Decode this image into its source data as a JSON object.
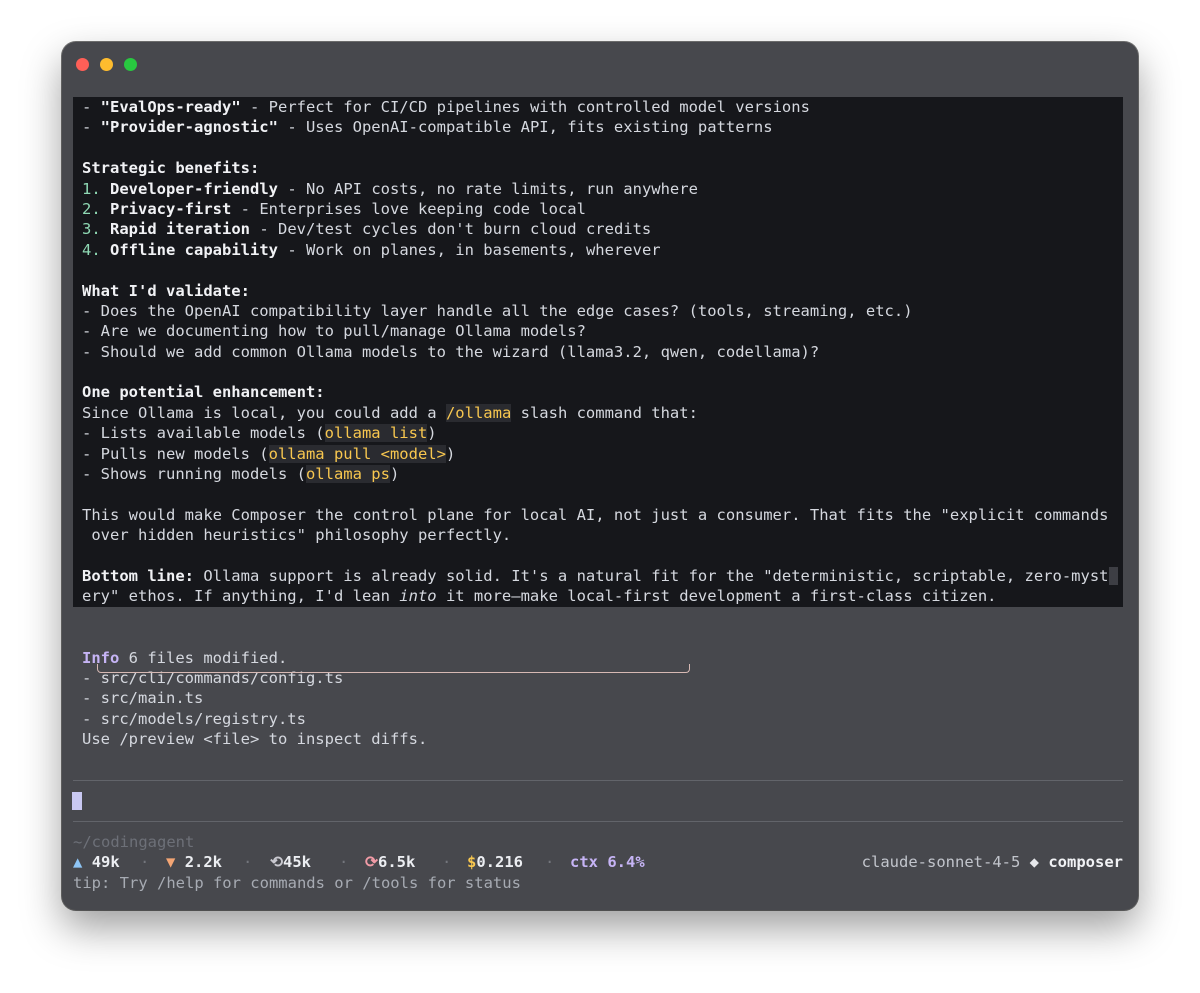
{
  "response": {
    "bullets_top": [
      {
        "bold": "\"EvalOps-ready\"",
        "rest": " - Perfect for CI/CD pipelines with controlled model versions"
      },
      {
        "bold": "\"Provider-agnostic\"",
        "rest": " - Uses OpenAI-compatible API, fits existing patterns"
      }
    ],
    "strategic": {
      "heading": "Strategic benefits:",
      "items": [
        {
          "n": "1.",
          "bold": "Developer-friendly",
          "rest": " - No API costs, no rate limits, run anywhere"
        },
        {
          "n": "2.",
          "bold": "Privacy-first",
          "rest": " - Enterprises love keeping code local"
        },
        {
          "n": "3.",
          "bold": "Rapid iteration",
          "rest": " - Dev/test cycles don't burn cloud credits"
        },
        {
          "n": "4.",
          "bold": "Offline capability",
          "rest": " - Work on planes, in basements, wherever"
        }
      ]
    },
    "validate": {
      "heading": "What I'd validate:",
      "items": [
        "- Does the OpenAI compatibility layer handle all the edge cases? (tools, streaming, etc.)",
        "- Are we documenting how to pull/manage Ollama models?",
        "- Should we add common Ollama models to the wizard (llama3.2, qwen, codellama)?"
      ]
    },
    "enhancement": {
      "heading": "One potential enhancement:",
      "intro_pre": "Since Ollama is local, you could add a ",
      "intro_code": "/ollama",
      "intro_post": " slash command that:",
      "items": [
        {
          "pre": "- Lists available models (",
          "code": "ollama list",
          "post": ")"
        },
        {
          "pre": "- Pulls new models (",
          "code": "ollama pull <model>",
          "post": ")"
        },
        {
          "pre": "- Shows running models (",
          "code": "ollama ps",
          "post": ")"
        }
      ]
    },
    "composer_para": {
      "line1": "This would make Composer the control plane for local AI, not just a consumer. That fits the \"explicit commands",
      "line2": " over hidden heuristics\" philosophy perfectly."
    },
    "bottom_line": {
      "label": "Bottom line:",
      "line1_rest": " Ollama support is already solid. It's a natural fit for the \"deterministic, scriptable, zero-myst",
      "line2_pre": "ery\" ethos. If anything, I'd lean ",
      "line2_em": "into",
      "line2_post": " it more—make local-first development a first-class citizen."
    }
  },
  "info": {
    "label": "Info",
    "message": " 6 files modified.",
    "files": [
      "- src/cli/commands/config.ts",
      "- src/main.ts",
      "- src/models/registry.ts"
    ],
    "hint": "Use /preview <file> to inspect diffs."
  },
  "status": {
    "cwd": "~/codingagent",
    "tokens_up": "49k",
    "tokens_down": "2.2k",
    "cache_read": "45k",
    "cache_write": "6.5k",
    "cost": "0.216",
    "cost_symbol": "$",
    "ctx_label": "ctx",
    "ctx_value": "6.4%",
    "model": "claude-sonnet-4-5",
    "mode": "composer",
    "tip": "tip: Try /help for commands or /tools for status",
    "icons": {
      "up": "triangle-up-icon",
      "down": "triangle-down-icon",
      "cache_read": "refresh-icon",
      "cache_write": "cycle-icon",
      "mode": "diamond-icon"
    }
  },
  "colors": {
    "window_bg": "#47484d",
    "output_bg": "#16171b",
    "code_fg": "#f8c74f",
    "accent_purple": "#c6b4f5",
    "number_green": "#8fd9b4"
  }
}
